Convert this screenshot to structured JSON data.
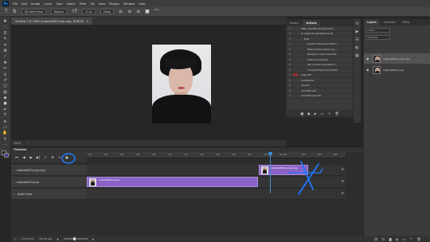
{
  "menubar": {
    "logo": "Ps",
    "items": [
      "File",
      "Edit",
      "Image",
      "Layer",
      "Type",
      "Select",
      "Filter",
      "3D",
      "View",
      "Plugins",
      "Window",
      "Help"
    ]
  },
  "options": {
    "font_family": "GD Vent Prime",
    "font_style": "Regular",
    "font_size": "21 pt",
    "antialias": "Sharp"
  },
  "document": {
    "tab_title": "Untitled-1 @ 100% (outpost0001.png copy, RGB/16)",
    "zoom": "100%"
  },
  "actions_panel": {
    "tabs": [
      "History",
      "Actions"
    ],
    "rows": [
      {
        "label": "Make Shuffle Shining Fadd...",
        "red": false,
        "level": 0
      },
      {
        "label": "to make the gif @exmoiidt",
        "red": false,
        "level": 0
      },
      {
        "label": "Edit",
        "red": false,
        "level": 1
      },
      {
        "label": "Create Frame Animation",
        "red": false,
        "level": 2
      },
      {
        "label": "Make Frames From Lay...",
        "red": false,
        "level": 2
      },
      {
        "label": "Reverse current animati...",
        "red": false,
        "level": 2
      },
      {
        "label": "Select All Frames",
        "red": false,
        "level": 2
      },
      {
        "label": "Set current animation f...",
        "red": false,
        "level": 2
      },
      {
        "label": "Convert Frame Animation",
        "red": false,
        "level": 2
      },
      {
        "label": "Logo GIF",
        "red": true,
        "level": 0
      },
      {
        "label": "bombaclat",
        "red": false,
        "level": 0
      },
      {
        "label": "moodd",
        "red": false,
        "level": 0
      },
      {
        "label": "moodd4 bed",
        "red": false,
        "level": 0
      },
      {
        "label": "moodd4 logo #1",
        "red": false,
        "level": 0
      }
    ]
  },
  "layers_panel": {
    "tabs": [
      "Layers",
      "Channels",
      "Paths"
    ],
    "kind": "Kind",
    "blend": "Normal",
    "layers": [
      {
        "name": "outpost0001.png copy",
        "selected": true
      },
      {
        "name": "outpost0001.png",
        "selected": false
      }
    ]
  },
  "timeline": {
    "title": "Timeline",
    "ruler_ticks": [
      "00",
      "02f",
      "04f",
      "06f",
      "08f",
      "10f",
      "12f",
      "14f",
      "16f",
      "18f",
      "20f",
      "22f",
      "01:00f",
      "02f",
      "04f",
      "06f"
    ],
    "tracks": [
      {
        "label": "outpost0001.png copy",
        "clip": "outpost0001.png copy"
      },
      {
        "label": "outpost0001.png",
        "clip": "outpost0001.png"
      },
      {
        "label": "Audio Track",
        "clip": ""
      }
    ],
    "timecode": "0:00:00:00",
    "fps": "(30.00 fps)"
  },
  "colors": {
    "clip": "#8a63c6",
    "accent_blue": "#3d8bd8",
    "annotation_blue": "#1f78ff"
  }
}
